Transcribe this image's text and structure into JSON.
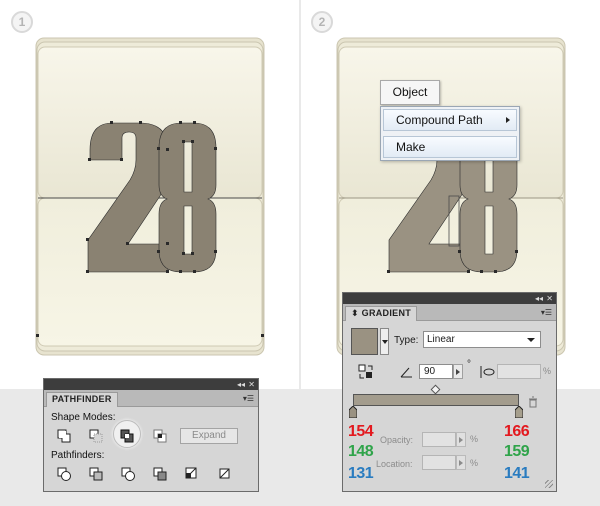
{
  "steps": [
    {
      "badge": "1"
    },
    {
      "badge": "2"
    }
  ],
  "artwork": {
    "digits": "28",
    "digit_color": "#8a8272",
    "card_color": "#f5f3e4"
  },
  "context_menu": {
    "object_label": "Object",
    "compound_path_label": "Compound Path",
    "make_label": "Make"
  },
  "pathfinder_panel": {
    "title": "PATHFINDER",
    "shape_modes_label": "Shape Modes:",
    "pathfinders_label": "Pathfinders:",
    "expand_label": "Expand",
    "selected_shape_mode": "exclude",
    "shape_mode_icons": [
      "unite-icon",
      "minus-front-icon",
      "exclude-icon",
      "intersect-icon"
    ],
    "pathfinder_icons": [
      "divide-icon",
      "trim-icon",
      "merge-icon",
      "crop-icon",
      "outline-icon",
      "minus-back-icon"
    ]
  },
  "gradient_panel": {
    "title": "GRADIENT",
    "type_label": "Type:",
    "type_value": "Linear",
    "angle_value": "90",
    "degree_symbol": "°",
    "aspect_percent": "%",
    "opacity_label": "Opacity:",
    "opacity_percent": "%",
    "location_label": "Location:",
    "location_percent": "%",
    "left_stop_rgb": [
      "154",
      "148",
      "131"
    ],
    "right_stop_rgb": [
      "166",
      "159",
      "141"
    ],
    "swatch_color": "#9a9282"
  }
}
